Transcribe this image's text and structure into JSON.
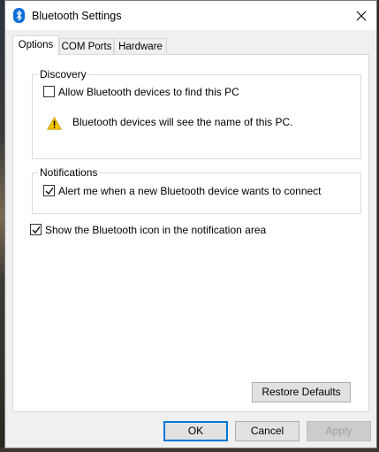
{
  "window": {
    "title": "Bluetooth Settings"
  },
  "tabs": [
    {
      "label": "Options",
      "active": true
    },
    {
      "label": "COM Ports",
      "active": false
    },
    {
      "label": "Hardware",
      "active": false
    }
  ],
  "discovery": {
    "legend": "Discovery",
    "allow_find": {
      "label": "Allow Bluetooth devices to find this PC",
      "checked": false
    },
    "warning_text": "Bluetooth devices will see the name of this PC.",
    "warning_icon": "warning-icon"
  },
  "notifications": {
    "legend": "Notifications",
    "alert_new": {
      "label": "Alert me when a new Bluetooth device wants to connect",
      "checked": true
    }
  },
  "show_icon": {
    "label": "Show the Bluetooth icon in the notification area",
    "checked": true
  },
  "buttons": {
    "restore_defaults": "Restore Defaults",
    "ok": "OK",
    "cancel": "Cancel",
    "apply": "Apply"
  },
  "colors": {
    "accent": "#0078d7",
    "bluetooth_icon": "#0a6ed8",
    "warning": "#f5c400"
  }
}
